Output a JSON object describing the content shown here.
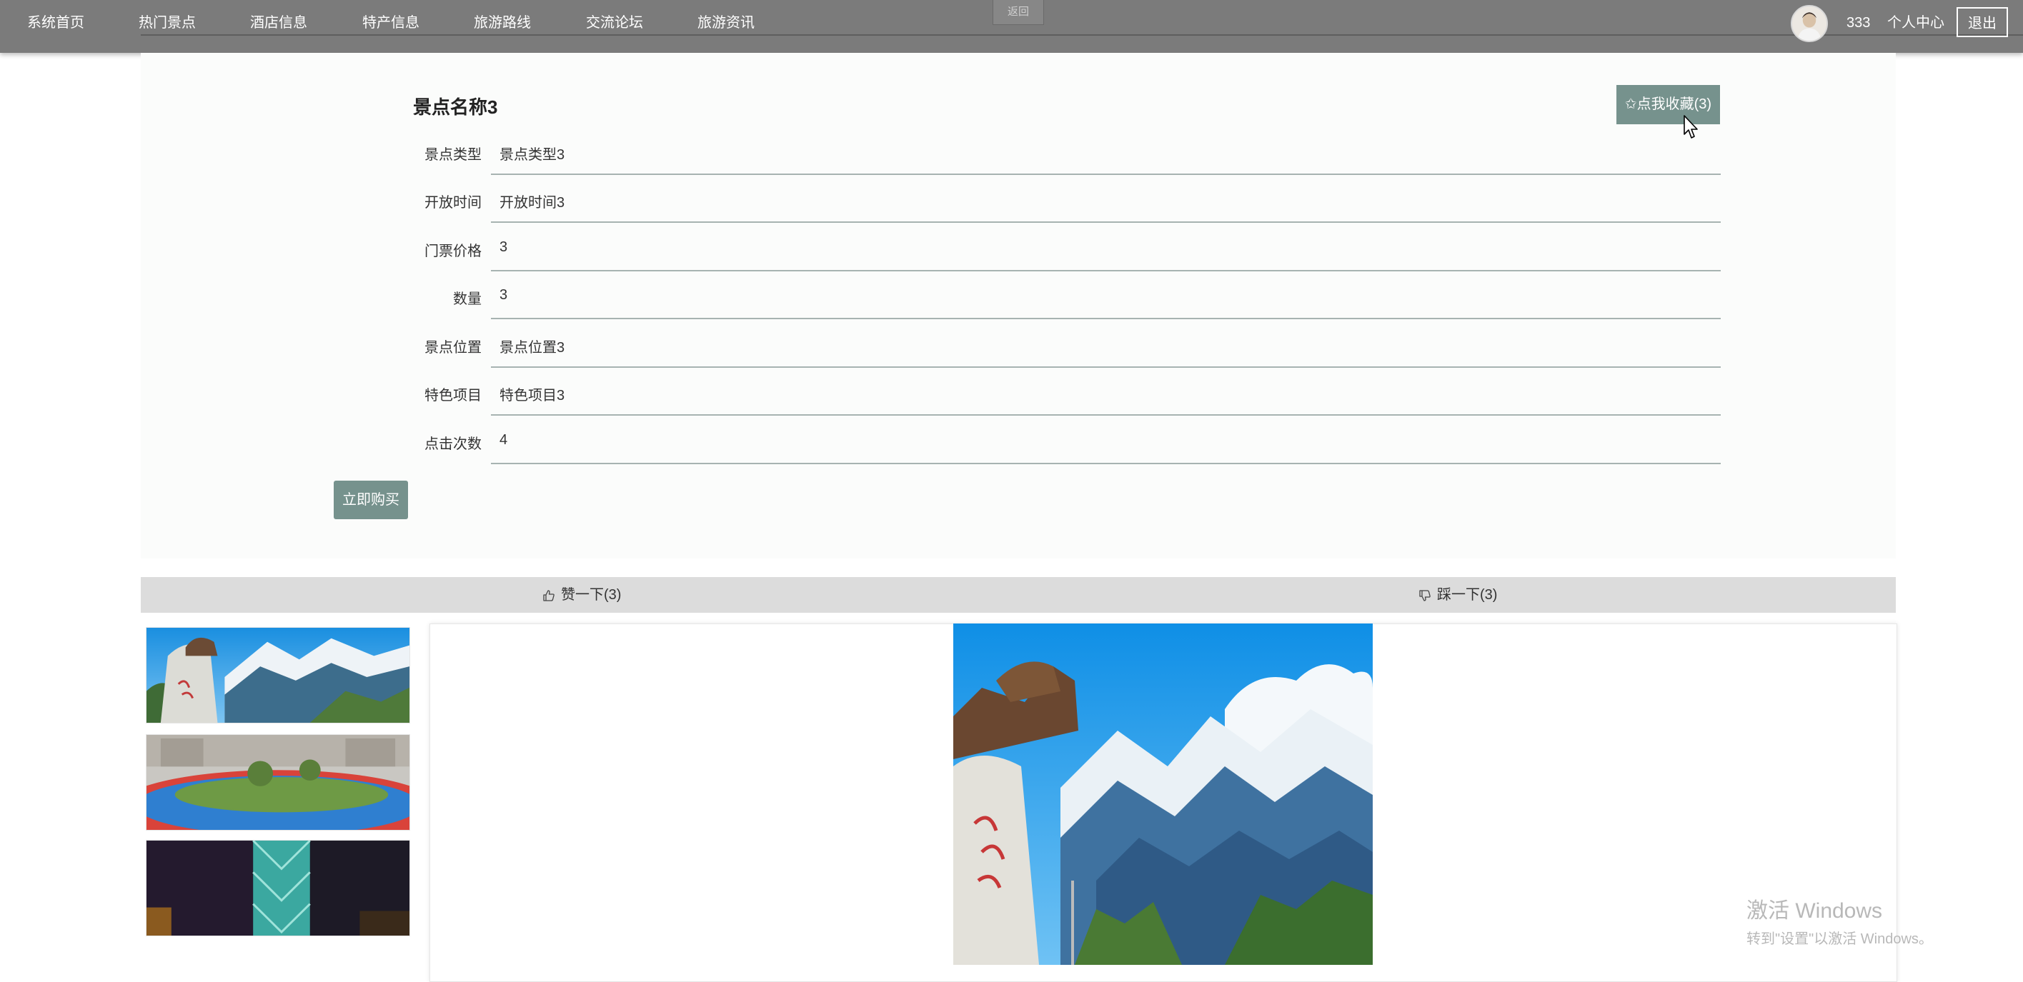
{
  "nav": {
    "items": [
      {
        "label": "系统首页"
      },
      {
        "label": "热门景点"
      },
      {
        "label": "酒店信息"
      },
      {
        "label": "特产信息"
      },
      {
        "label": "旅游路线"
      },
      {
        "label": "交流论坛"
      },
      {
        "label": "旅游资讯"
      }
    ],
    "back_label": "返回",
    "username": "333",
    "user_center_label": "个人中心",
    "logout_label": "退出"
  },
  "detail": {
    "title": "景点名称3",
    "favorite_label": "✩点我收藏(3)",
    "fields": [
      {
        "label": "景点类型",
        "value": "景点类型3"
      },
      {
        "label": "开放时间",
        "value": "开放时间3"
      },
      {
        "label": "门票价格",
        "value": "3"
      },
      {
        "label": "数量",
        "value": "3"
      },
      {
        "label": "景点位置",
        "value": "景点位置3"
      },
      {
        "label": "特色项目",
        "value": "特色项目3"
      },
      {
        "label": "点击次数",
        "value": "4"
      }
    ],
    "buy_label": "立即购买"
  },
  "vote": {
    "like_label": "赞一下(3)",
    "dislike_label": "踩一下(3)"
  },
  "gallery": {
    "thumbnails": [
      "tiger-rock-mountain-photo",
      "park-running-track-photo",
      "night-building-photo"
    ],
    "main_image": "tiger-rock-mountain-photo"
  },
  "watermark": {
    "title": "激活 Windows",
    "subtitle": "转到\"设置\"以激活 Windows。"
  },
  "colors": {
    "topbar": "#7b7b7b",
    "accent_button": "#76928d",
    "vote_bar": "#dcdcdc"
  }
}
